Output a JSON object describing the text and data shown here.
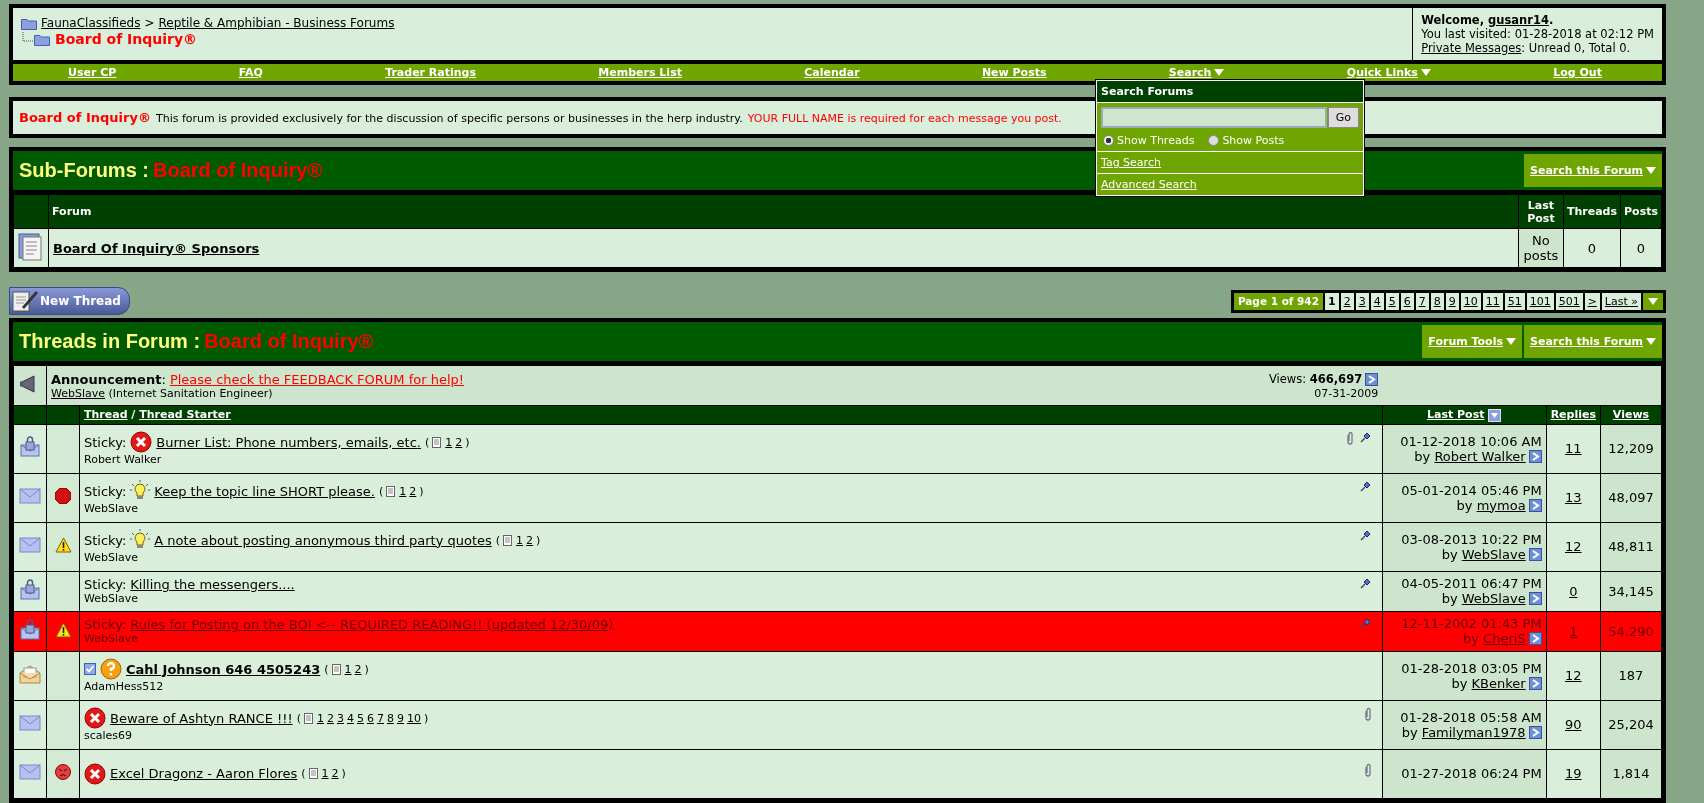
{
  "breadcrumb": {
    "links": [
      "FaunaClassifieds",
      "Reptile & Amphibian - Business Forums"
    ],
    "separator": ">",
    "current": "Board of Inquiry®"
  },
  "welcome": {
    "before": "Welcome,",
    "username": "gusanr14",
    "after": ".",
    "last_visited": "You last visited: 01-28-2018 at 02:12 PM",
    "pm_link": "Private Messages",
    "pm_status": ": Unread 0, Total 0."
  },
  "nav": [
    {
      "label": "User CP",
      "menu": false
    },
    {
      "label": "FAQ",
      "menu": false
    },
    {
      "label": "Trader Ratings",
      "menu": false
    },
    {
      "label": "Members List",
      "menu": false
    },
    {
      "label": "Calendar",
      "menu": false
    },
    {
      "label": "New Posts",
      "menu": false
    },
    {
      "label": "Search",
      "menu": true
    },
    {
      "label": "Quick Links",
      "menu": true
    },
    {
      "label": "Log Out",
      "menu": false
    }
  ],
  "search_menu": {
    "title": "Search Forums",
    "button": "Go",
    "options": [
      {
        "label": "Show Threads",
        "selected": true
      },
      {
        "label": "Show Posts",
        "selected": false
      }
    ],
    "links": [
      "Tag Search",
      "Advanced Search"
    ]
  },
  "description": {
    "title": "Board of Inquiry®",
    "text": "This forum is provided exclusively for the discussion of specific persons or businesses in the herp industry.",
    "notice": "YOUR FULL NAME is required for each message you post."
  },
  "subforums": {
    "heading": "Sub-Forums :",
    "forum_name": "Board of Inquiry®",
    "search_button": "Search this Forum",
    "columns": [
      "Forum",
      "Last Post",
      "Threads",
      "Posts"
    ],
    "rows": [
      {
        "name": "Board Of Inquiry® Sponsors",
        "last_post": "No posts",
        "threads": "0",
        "posts": "0"
      }
    ]
  },
  "new_thread": "New Thread",
  "pagination": {
    "label": "Page 1 of 942",
    "pages": [
      {
        "label": "1",
        "selected": true
      },
      {
        "label": "2",
        "selected": false
      },
      {
        "label": "3",
        "selected": false
      },
      {
        "label": "4",
        "selected": false
      },
      {
        "label": "5",
        "selected": false
      },
      {
        "label": "6",
        "selected": false
      },
      {
        "label": "7",
        "selected": false
      },
      {
        "label": "8",
        "selected": false
      },
      {
        "label": "9",
        "selected": false
      },
      {
        "label": "10",
        "selected": false
      },
      {
        "label": "11",
        "selected": false
      },
      {
        "label": "51",
        "selected": false
      },
      {
        "label": "101",
        "selected": false
      },
      {
        "label": "501",
        "selected": false
      },
      {
        "label": ">",
        "selected": false
      },
      {
        "label": "Last »",
        "selected": false
      }
    ]
  },
  "threads": {
    "heading": "Threads in Forum :",
    "forum_name": "Board of Inquiry®",
    "tools": [
      {
        "label": "Forum Tools"
      },
      {
        "label": "Search this Forum"
      }
    ],
    "announcement": {
      "label": "Announcement",
      "separator": ":",
      "title": "Please check the FEEDBACK FORUM for help!",
      "author": "WebSlave",
      "author_title": "(Internet Sanitation Engineer)",
      "views_label": "Views:",
      "views": "466,697",
      "date": "07-31-2009"
    },
    "columns": {
      "thread": "Thread",
      "divider": "/",
      "starter": "Thread Starter",
      "last_post": "Last Post",
      "replies": "Replies",
      "views": "Views"
    },
    "page_brackets": [
      "(",
      ")"
    ],
    "rows": [
      {
        "status": {
          "kind": "locked"
        },
        "prefix": "Sticky:",
        "icons": [
          {
            "kind": "x"
          }
        ],
        "title": "Burner List: Phone numbers, emails, etc.",
        "unread": false,
        "highlighted": false,
        "pages": [
          "1",
          "2"
        ],
        "starter": "Robert Walker",
        "attachment": true,
        "pinned": true,
        "date": "01-12-2018 10:06 AM",
        "by": "by",
        "last_poster": "Robert Walker",
        "replies": "11",
        "views": "12,209"
      },
      {
        "status": {
          "kind": "envelope"
        },
        "post_icon": {
          "kind": "stop"
        },
        "prefix": "Sticky:",
        "icons": [
          {
            "kind": "bulb"
          }
        ],
        "title": "Keep the topic line SHORT please.",
        "unread": false,
        "highlighted": false,
        "pages": [
          "1",
          "2"
        ],
        "starter": "WebSlave",
        "attachment": false,
        "pinned": true,
        "date": "05-01-2014 05:46 PM",
        "by": "by",
        "last_poster": "mymoa",
        "replies": "13",
        "views": "48,097"
      },
      {
        "status": {
          "kind": "envelope"
        },
        "post_icon": {
          "kind": "warning"
        },
        "prefix": "Sticky:",
        "icons": [
          {
            "kind": "bulb"
          }
        ],
        "title": "A note about posting anonymous third party quotes",
        "unread": false,
        "highlighted": false,
        "pages": [
          "1",
          "2"
        ],
        "starter": "WebSlave",
        "attachment": false,
        "pinned": true,
        "date": "03-08-2013 10:22 PM",
        "by": "by",
        "last_poster": "WebSlave",
        "replies": "12",
        "views": "48,811"
      },
      {
        "status": {
          "kind": "locked"
        },
        "prefix": "Sticky:",
        "icons": [],
        "title": "Killing the messengers....",
        "unread": false,
        "highlighted": false,
        "pages": [],
        "starter": "WebSlave",
        "attachment": false,
        "pinned": true,
        "date": "04-05-2011 06:47 PM",
        "by": "by",
        "last_poster": "WebSlave",
        "replies": "0",
        "views": "34,145"
      },
      {
        "status": {
          "kind": "locked"
        },
        "post_icon": {
          "kind": "warning"
        },
        "prefix": "Sticky:",
        "icons": [],
        "title": "Rules for Posting on the BOI <-- REQUIRED READING!! (updated 12/30/09)",
        "unread": false,
        "highlighted": true,
        "pages": [],
        "starter": "WebSlave",
        "attachment": false,
        "pinned": true,
        "date": "12-11-2002 01:43 PM",
        "by": "by",
        "last_poster": "CheriS",
        "replies": "1",
        "views": "54,290"
      },
      {
        "status": {
          "kind": "open"
        },
        "icons": [
          {
            "kind": "checkbox"
          },
          {
            "kind": "question"
          }
        ],
        "title": "Cahl Johnson 646 4505243",
        "unread": true,
        "highlighted": false,
        "pages": [
          "1",
          "2"
        ],
        "starter": "AdamHess512",
        "attachment": false,
        "pinned": false,
        "date": "01-28-2018 03:05 PM",
        "by": "by",
        "last_poster": "KBenker",
        "replies": "12",
        "views": "187"
      },
      {
        "status": {
          "kind": "envelope"
        },
        "icons": [
          {
            "kind": "x"
          }
        ],
        "title": "Beware of Ashtyn RANCE !!!",
        "unread": false,
        "highlighted": false,
        "pages": [
          "1",
          "2",
          "3",
          "4",
          "5",
          "6",
          "7",
          "8",
          "9",
          "10"
        ],
        "starter": "scales69",
        "attachment": true,
        "pinned": false,
        "date": "01-28-2018 05:58 AM",
        "by": "by",
        "last_poster": "Familyman1978",
        "replies": "90",
        "views": "25,204"
      },
      {
        "status": {
          "kind": "envelope"
        },
        "post_icon": {
          "kind": "angry"
        },
        "icons": [
          {
            "kind": "x"
          }
        ],
        "title": "Excel Dragonz - Aaron Flores",
        "unread": false,
        "highlighted": false,
        "pages": [
          "1",
          "2"
        ],
        "attachment": true,
        "pinned": false,
        "date": "01-27-2018 06:24 PM",
        "replies": "19",
        "views": "1,814"
      }
    ]
  }
}
